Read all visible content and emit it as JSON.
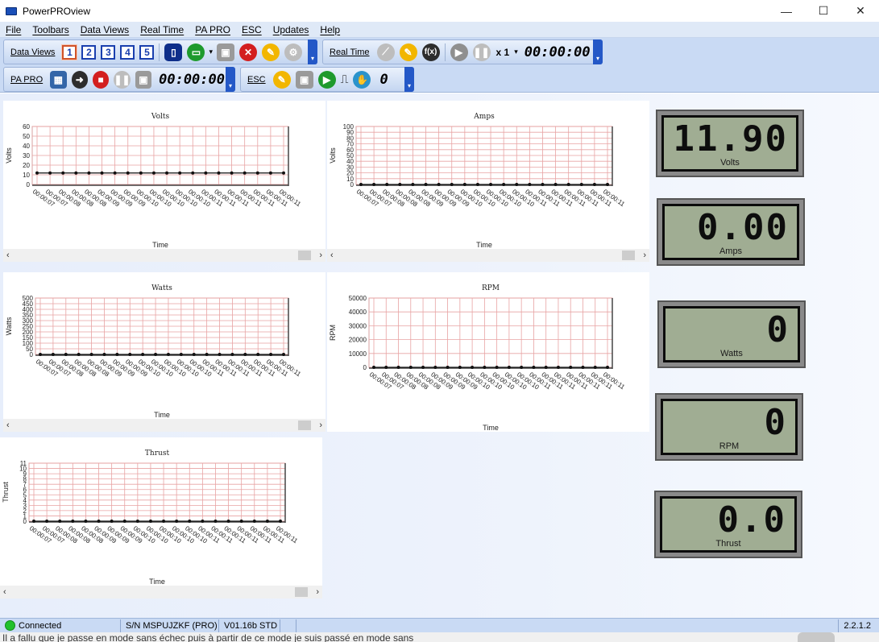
{
  "window": {
    "title": "PowerPROview",
    "minimize": "—",
    "maximize": "☐",
    "close": "✕"
  },
  "menu": [
    "File",
    "Toolbars",
    "Data Views",
    "Real Time",
    "PA PRO",
    "ESC",
    "Updates",
    "Help"
  ],
  "toolbar_dataviews": {
    "label": "Data Views",
    "views": [
      "1",
      "2",
      "3",
      "4",
      "5"
    ]
  },
  "toolbar_realtime": {
    "label": "Real Time",
    "fx": "f(x)",
    "speed": "x 1",
    "timer": "00:00:00"
  },
  "toolbar_papro": {
    "label": "PA PRO",
    "timer": "00:00:00"
  },
  "toolbar_esc": {
    "label": "ESC",
    "count": "0"
  },
  "time_ticks": [
    "00:00:07",
    "00:00:07",
    "00:00:08",
    "00:00:08",
    "00:00:08",
    "00:00:09",
    "00:00:09",
    "00:00:09",
    "00:00:10",
    "00:00:10",
    "00:00:10",
    "00:00:10",
    "00:00:10",
    "00:00:11",
    "00:00:11",
    "00:00:11",
    "00:00:11",
    "00:00:11",
    "00:00:11",
    "00:00:11"
  ],
  "chart_data": [
    {
      "type": "line",
      "title": "Volts",
      "xlabel": "Time",
      "ylabel": "Volts",
      "ylim": [
        0,
        60
      ],
      "yticks": [
        0,
        10,
        20,
        30,
        40,
        50,
        60
      ],
      "series": [
        {
          "values": [
            11.9,
            11.9,
            11.9,
            11.9,
            11.9,
            11.9,
            11.9,
            11.9,
            11.9,
            11.9,
            11.9,
            11.9,
            11.9,
            11.9,
            11.9,
            11.9,
            11.9,
            11.9,
            11.9,
            11.9
          ]
        }
      ]
    },
    {
      "type": "line",
      "title": "Amps",
      "xlabel": "Time",
      "ylabel": "Volts",
      "ylim": [
        0,
        100
      ],
      "yticks": [
        0,
        10,
        20,
        30,
        40,
        50,
        60,
        70,
        80,
        90,
        100
      ],
      "series": [
        {
          "values": [
            0,
            0,
            0,
            0,
            0,
            0,
            0,
            0,
            0,
            0,
            0,
            0,
            0,
            0,
            0,
            0,
            0,
            0,
            0,
            0
          ]
        }
      ]
    },
    {
      "type": "line",
      "title": "Watts",
      "xlabel": "Time",
      "ylabel": "Watts",
      "ylim": [
        0,
        500
      ],
      "yticks": [
        0,
        50,
        100,
        150,
        200,
        250,
        300,
        350,
        400,
        450,
        500
      ],
      "series": [
        {
          "values": [
            0,
            0,
            0,
            0,
            0,
            0,
            0,
            0,
            0,
            0,
            0,
            0,
            0,
            0,
            0,
            0,
            0,
            0,
            0,
            0
          ]
        }
      ]
    },
    {
      "type": "line",
      "title": "RPM",
      "xlabel": "Time",
      "ylabel": "RPM",
      "ylim": [
        0,
        50000
      ],
      "yticks": [
        0,
        10000,
        20000,
        30000,
        40000,
        50000
      ],
      "series": [
        {
          "values": [
            0,
            0,
            0,
            0,
            0,
            0,
            0,
            0,
            0,
            0,
            0,
            0,
            0,
            0,
            0,
            0,
            0,
            0,
            0,
            0
          ]
        }
      ]
    },
    {
      "type": "line",
      "title": "Thrust",
      "xlabel": "Time",
      "ylabel": "Thrust",
      "ylim": [
        0,
        11
      ],
      "yticks": [
        0,
        1,
        2,
        3,
        4,
        5,
        6,
        7,
        8,
        9,
        10,
        11
      ],
      "series": [
        {
          "values": [
            0,
            0,
            0,
            0,
            0,
            0,
            0,
            0,
            0,
            0,
            0,
            0,
            0,
            0,
            0,
            0,
            0,
            0,
            0,
            0
          ]
        }
      ]
    }
  ],
  "meters": [
    {
      "label": "Volts",
      "value": "11.90"
    },
    {
      "label": "Amps",
      "value": "0.00"
    },
    {
      "label": "Watts",
      "value": "0"
    },
    {
      "label": "RPM",
      "value": "0"
    },
    {
      "label": "Thrust",
      "value": "0.0"
    }
  ],
  "status": {
    "connection": "Connected",
    "serial": "S/N MSPUJZKF (PRO)",
    "firmware": "V01.16b STD",
    "version": "2.2.1.2"
  },
  "underlying_text": "Il a fallu que je passe en mode sans échec puis à partir de ce mode je suis passé en mode sans"
}
